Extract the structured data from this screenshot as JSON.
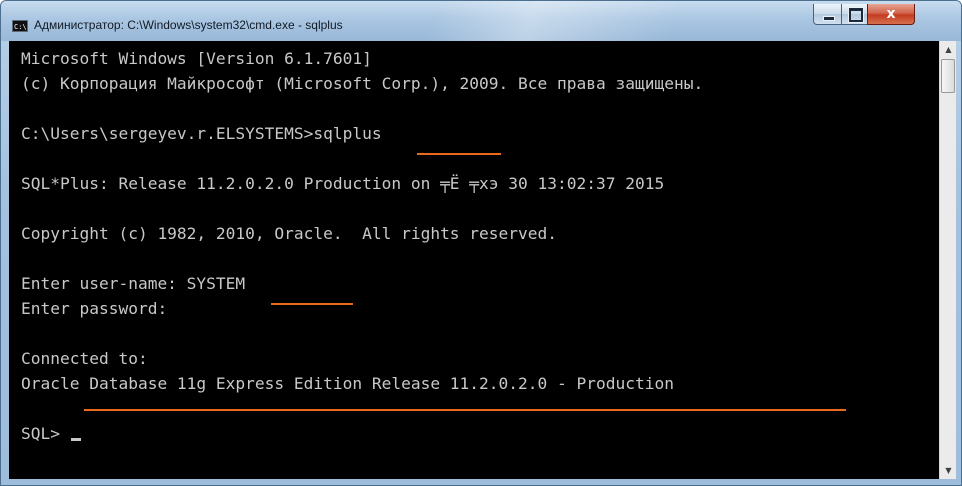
{
  "window": {
    "title": "Администратор: C:\\Windows\\system32\\cmd.exe - sqlplus",
    "app_icon_text": "C:\\",
    "close_glyph": "x"
  },
  "console": {
    "lines": [
      "Microsoft Windows [Version 6.1.7601]",
      "(c) Корпорация Майкрософт (Microsoft Corp.), 2009. Все права защищены.",
      "",
      "C:\\Users\\sergeyev.r.ELSYSTEMS>sqlplus",
      "",
      "SQL*Plus: Release 11.2.0.2.0 Production on ╤Ё ╤хэ 30 13:02:37 2015",
      "",
      "Copyright (c) 1982, 2010, Oracle.  All rights reserved.",
      "",
      "Enter user-name: SYSTEM",
      "Enter password:",
      "",
      "Connected to:",
      "Oracle Database 11g Express Edition Release 11.2.0.2.0 - Production",
      "",
      "SQL> "
    ]
  },
  "colors": {
    "console_bg": "#000000",
    "console_text": "#c8c8c8",
    "highlight_underline": "#ea6a1c",
    "close_button": "#c43c20"
  },
  "scrollbar": {
    "up_arrow": "▲",
    "down_arrow": "▼"
  }
}
